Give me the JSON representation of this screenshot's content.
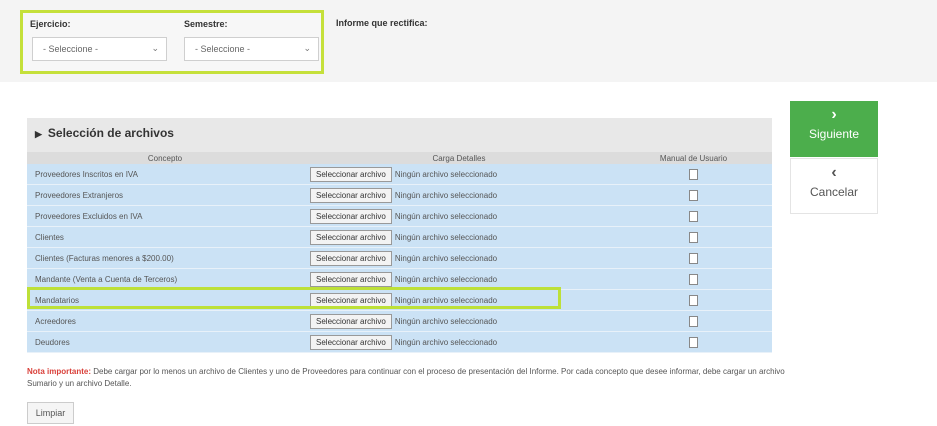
{
  "filters": {
    "ejercicio_label": "Ejercicio:",
    "ejercicio_value": "- Seleccione -",
    "semestre_label": "Semestre:",
    "semestre_value": "- Seleccione -",
    "informe_label": "Informe que rectifica:"
  },
  "panel": {
    "title": "Selección de archivos",
    "columns": [
      "Concepto",
      "Carga Detalles",
      "Manual de Usuario"
    ],
    "file_button_label": "Seleccionar archivo",
    "file_status": "Ningún archivo seleccionado",
    "rows": [
      {
        "concept": "Proveedores Inscritos en IVA"
      },
      {
        "concept": "Proveedores Extranjeros"
      },
      {
        "concept": "Proveedores Excluidos en IVA"
      },
      {
        "concept": "Clientes"
      },
      {
        "concept": "Clientes (Facturas menores a $200.00)"
      },
      {
        "concept": "Mandante (Venta a Cuenta de Terceros)"
      },
      {
        "concept": "Mandatarios"
      },
      {
        "concept": "Acreedores"
      },
      {
        "concept": "Deudores"
      }
    ]
  },
  "actions": {
    "next_label": "Siguiente",
    "next_icon": "chevron-right-icon",
    "cancel_label": "Cancelar",
    "cancel_icon": "chevron-left-icon",
    "clear_label": "Limpiar"
  },
  "note": {
    "important": "Nota importante:",
    "text": " Debe cargar por lo menos un archivo de Clientes y uno de Proveedores para continuar con el proceso de presentación del Informe. Por cada concepto que desee informar, debe cargar un archivo Sumario y un archivo Detalle."
  },
  "colors": {
    "accent_green": "#4cae4c",
    "highlight": "#c5e03a",
    "row_blue": "#cbe2f5",
    "important_red": "#d9403a"
  }
}
